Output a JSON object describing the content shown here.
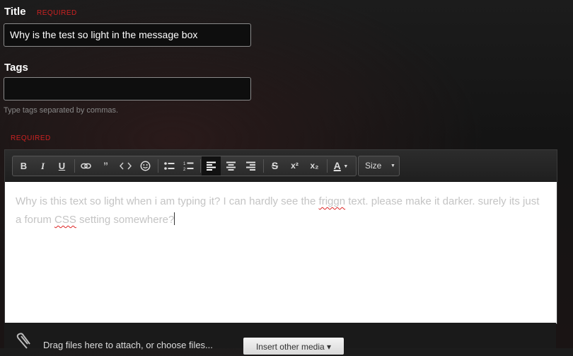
{
  "title_field": {
    "label": "Title",
    "required_label": "REQUIRED",
    "value": "Why is the test so light in the message box"
  },
  "tags_field": {
    "label": "Tags",
    "value": "",
    "hint": "Type tags separated by commas."
  },
  "message": {
    "required_label": "REQUIRED",
    "text_part1": "Why is this text so light when i am typing it? I can hardly see the ",
    "misspelled1": "friggn",
    "text_part2": " text. please make it darker. surely its just a forum ",
    "misspelled2": "CSS",
    "text_part3": " setting somewhere?"
  },
  "toolbar": {
    "bold": "B",
    "italic": "I",
    "underline": "U",
    "superscript": "x²",
    "subscript": "x₂",
    "font_color": "A",
    "size": "Size"
  },
  "attachments": {
    "drag_text": "Drag files here to attach, or choose files...",
    "insert_media_button": "Insert other media ▾"
  }
}
